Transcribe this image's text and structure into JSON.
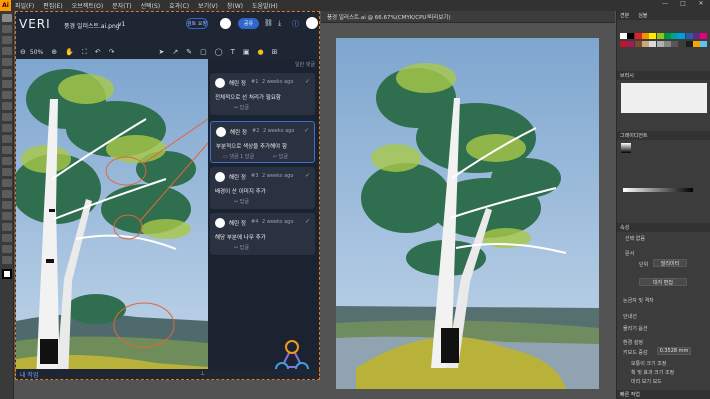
{
  "menu": {
    "logo": "Ai",
    "items": [
      "파일(F)",
      "편집(E)",
      "오브젝트(O)",
      "문자(T)",
      "선택(S)",
      "효과(C)",
      "보기(V)",
      "창(W)",
      "도움말(H)"
    ],
    "window_controls": [
      "—",
      "□",
      "✕"
    ]
  },
  "overlay": {
    "brand": "VERI",
    "file_name": "풍경 일러스트.ai.png",
    "version": "v1",
    "review_label": "검토 요청",
    "share_label": "공유",
    "zoom": "50%",
    "general_label": "일반 댓글",
    "my_label": "내 작업"
  },
  "comments": [
    {
      "author": "해린 정",
      "num": "#1",
      "time": "2 weeks ago",
      "text": "전체적으로 선 처리가 필요함",
      "reply": "답글"
    },
    {
      "author": "해린 정",
      "num": "#2",
      "time": "2 weeks ago",
      "text": "부분적으로 색상을 추가해야 함",
      "reply": "댓글 1 답글",
      "reply2": "답글"
    },
    {
      "author": "해린 정",
      "num": "#3",
      "time": "2 weeks ago",
      "text": "배경이 산 이미지 추가",
      "reply": "답글"
    },
    {
      "author": "해린 정",
      "num": "#4",
      "time": "2 weeks ago",
      "text": "해당 부분에 나무 추가",
      "reply": "답글"
    }
  ],
  "document": {
    "tab_title": "풍경 일러스트.ai @ 66.67%(CMYK/CPU 미리보기)",
    "close": "×"
  },
  "panel": {
    "tabs1": [
      "견본",
      "심볼"
    ],
    "tab_brush": "브러시",
    "tab_gradient": "그레이디언트",
    "tab_properties": "속성",
    "label_selection": "선택 없음",
    "label_document": "문서",
    "unit_label": "단위",
    "unit_value": "밀리미터",
    "artboard_button": "대지 편집",
    "label_rulers": "눈금자 및 격자",
    "label_guides": "안내선",
    "label_snap": "물리기 옵션",
    "label_preferences": "환경 설정",
    "keyboard_label": "키보드 증감",
    "keyboard_value": "0.3528 mm",
    "opt1": "모퉁이 크기 조정",
    "opt2": "획 및 효과 크기 조정",
    "opt3": "미리 보기 모드",
    "quick_actions": "빠른 작업"
  },
  "colors": {
    "accent": "#2e68c8",
    "sky_top": "#7ea6cf",
    "sky_bottom": "#c3d7ea",
    "overlay_dash": "#e07a20",
    "swatches": [
      "#ffffff",
      "#000000",
      "#e31e24",
      "#f39200",
      "#ffed00",
      "#95c11f",
      "#009640",
      "#00a19a",
      "#009fe3",
      "#2a5aa8",
      "#662483",
      "#e6007e",
      "#be1622",
      "#a3195b",
      "#7a4e2d",
      "#c8a97e",
      "#dadada",
      "#b0b0b0",
      "#878787",
      "#575756",
      "#3c3c3b",
      "#1d1d1b",
      "#f7a600",
      "#5bc5f2"
    ]
  }
}
